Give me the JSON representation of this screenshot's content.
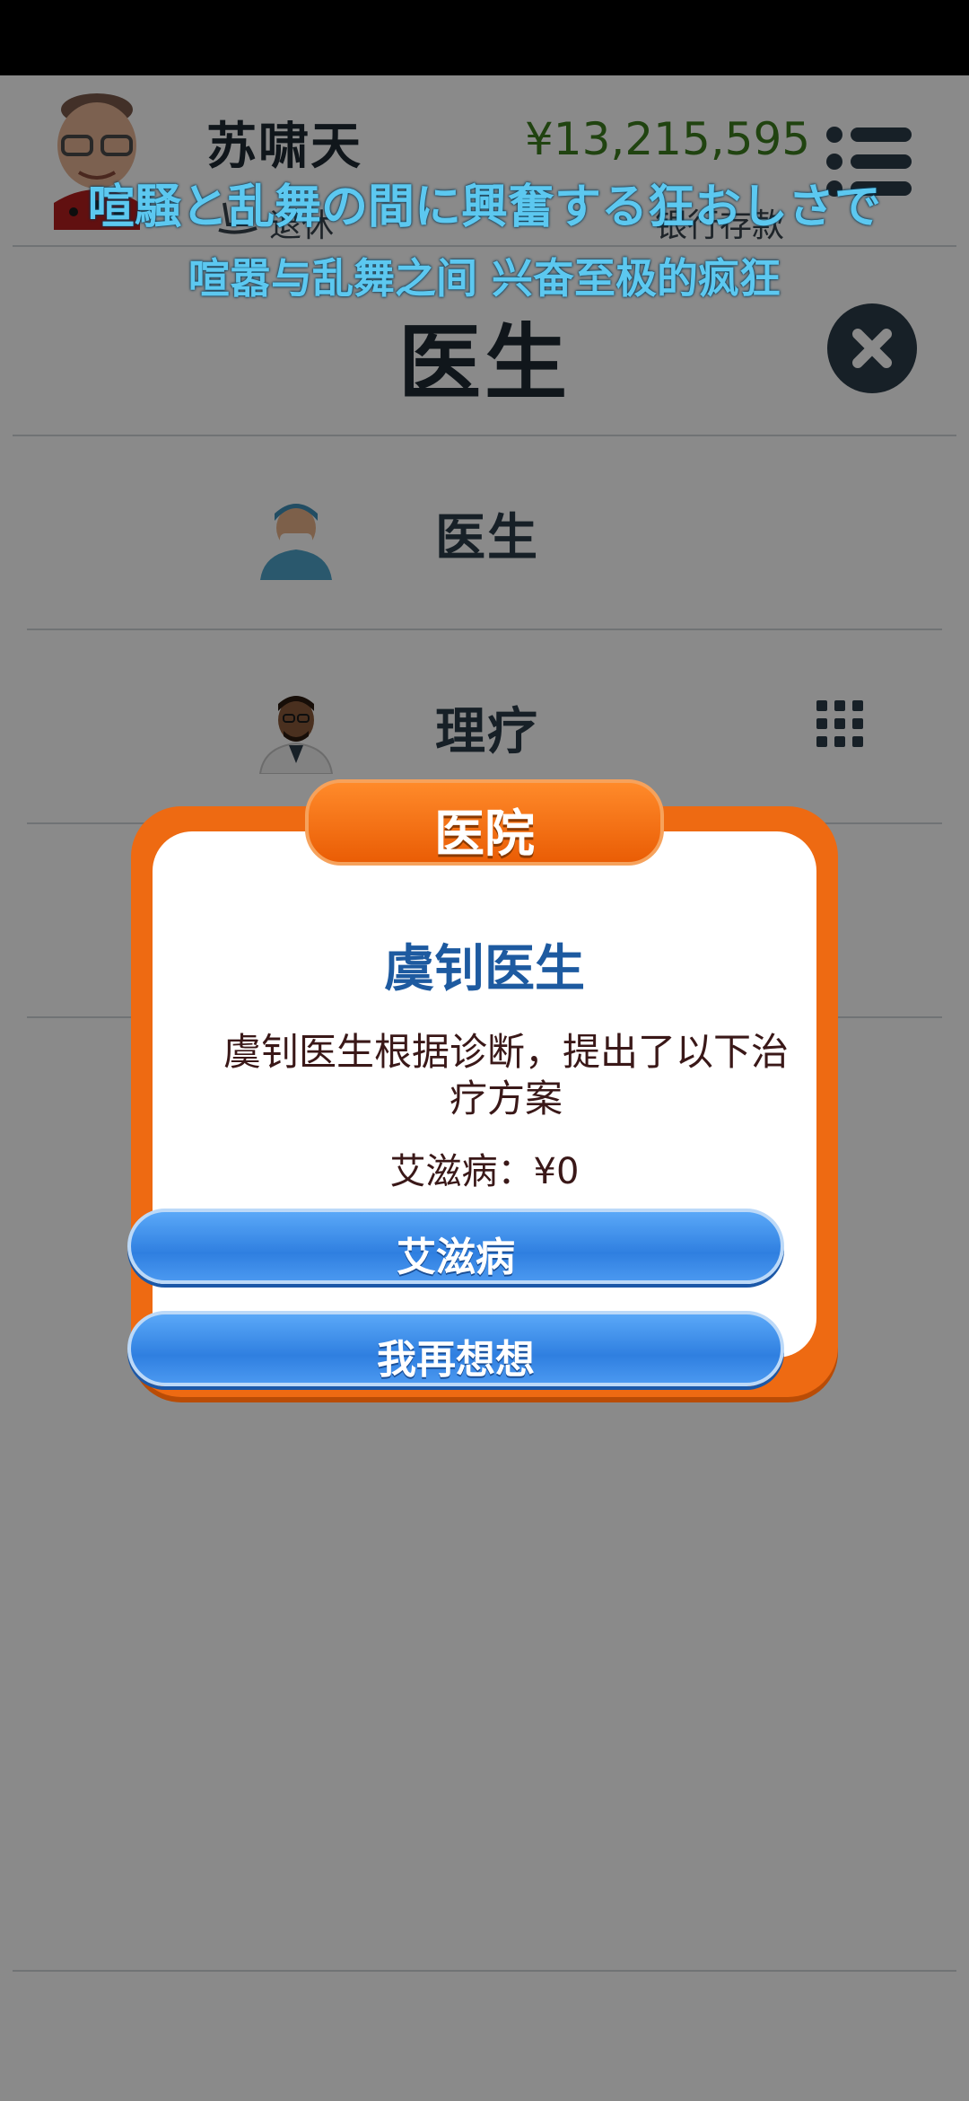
{
  "header": {
    "player_name": "苏啸天",
    "money": "¥13,215,595",
    "retire_label": "退休",
    "bank_label": "银行存款"
  },
  "page": {
    "title": "医生"
  },
  "list": {
    "items": [
      {
        "label": "医生",
        "icon": "doctor-nurse-icon"
      },
      {
        "label": "理疗",
        "icon": "doctor-physician-icon"
      }
    ]
  },
  "subtitles": {
    "japanese": "喧騒と乱舞の間に興奮する狂おしさで",
    "chinese": "喧嚣与乱舞之间 兴奋至极的疯狂"
  },
  "dialog": {
    "header": "医院",
    "title": "虞钊医生",
    "body": "虞钊医生根据诊断，提出了以下治疗方案",
    "price": "艾滋病：¥0",
    "primary_button": "艾滋病",
    "secondary_button": "我再想想"
  },
  "colors": {
    "money": "#3c7d1f",
    "dialog_frame": "#ee6a12",
    "dialog_title": "#1d5aa0",
    "button": "#2f7fe0",
    "subtitle": "#5cc8f0"
  }
}
